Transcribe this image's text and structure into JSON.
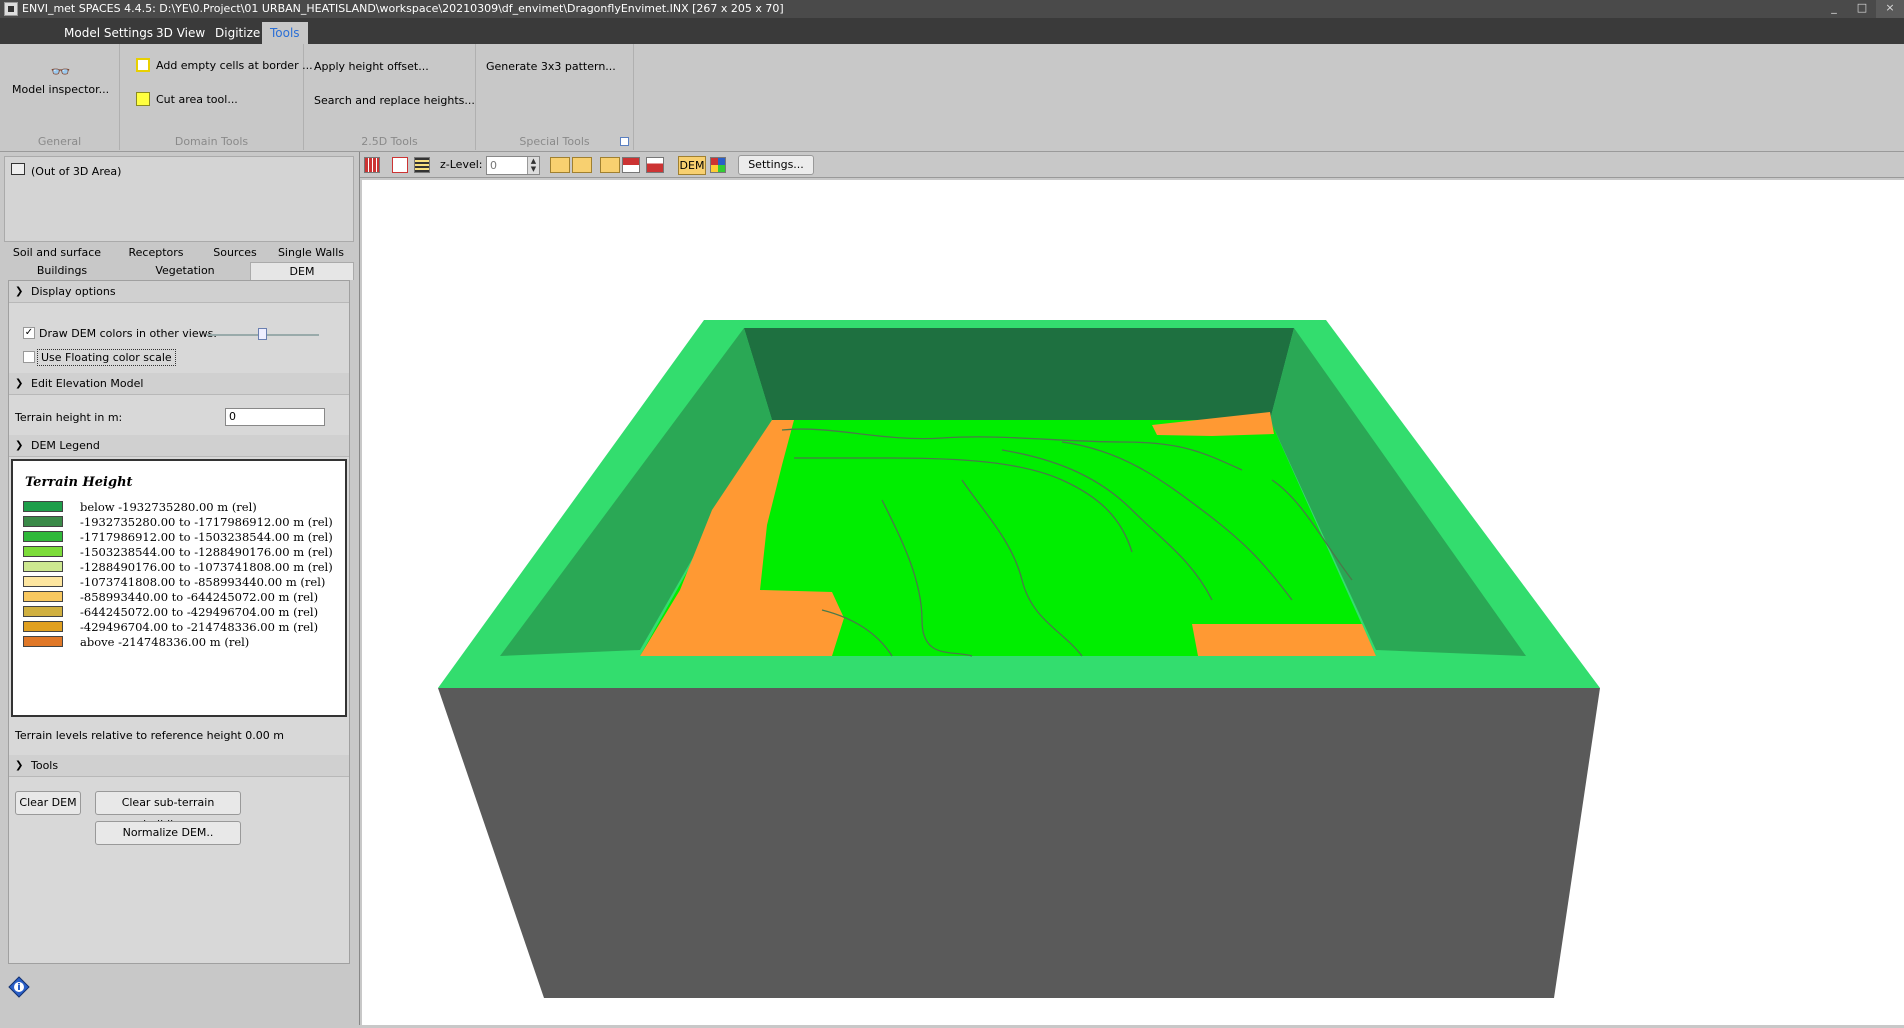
{
  "window": {
    "title": "ENVI_met SPACES 4.4.5:  D:\\YE\\0.Project\\01 URBAN_HEATISLAND\\workspace\\20210309\\df_envimet\\DragonflyEnvimet.INX [267 x 205 x 70]",
    "controls": [
      "_",
      "□",
      "×"
    ]
  },
  "menu": {
    "tabs": [
      "Model Settings",
      "3D View",
      "Digitize",
      "Tools"
    ],
    "active": "Tools"
  },
  "ribbon": {
    "groups": {
      "general": {
        "label": "General",
        "model_inspector": "Model inspector..."
      },
      "domain": {
        "label": "Domain Tools",
        "add_empty_cells": "Add empty cells at border ...",
        "cut_area": "Cut area tool..."
      },
      "two_half_d": {
        "label": "2.5D Tools",
        "apply_height": "Apply height offset...",
        "search_replace": "Search and replace heights..."
      },
      "special": {
        "label": "Special Tools",
        "generate_pattern": "Generate 3x3 pattern..."
      }
    }
  },
  "left_panel": {
    "area_label": "(Out of 3D Area)",
    "tabs_row1": [
      "Soil and surface",
      "Receptors",
      "Sources",
      "Single Walls"
    ],
    "tabs_row2": [
      "Buildings",
      "Vegetation",
      "DEM"
    ],
    "active_tab": "DEM",
    "display_options": {
      "title": "Display options",
      "draw_dem_colors": "Draw DEM colors in other views.",
      "draw_dem_checked": true,
      "floating_scale": "Use Floating color scale",
      "floating_checked": false,
      "slider_level": 0.5
    },
    "edit_elevation": {
      "title": "Edit Elevation Model",
      "terrain_label": "Terrain height in m:",
      "terrain_value": "0"
    },
    "legend": {
      "title": "DEM Legend",
      "heading": "Terrain Height",
      "entries": [
        {
          "color": "#1e9e4a",
          "label": "below -1932735280.00 m (rel)"
        },
        {
          "color": "#3a8a48",
          "label": "-1932735280.00 to -1717986912.00 m (rel)"
        },
        {
          "color": "#2fb83a",
          "label": "-1717986912.00 to -1503238544.00 m (rel)"
        },
        {
          "color": "#7cdc3a",
          "label": "-1503238544.00 to -1288490176.00 m (rel)"
        },
        {
          "color": "#cde890",
          "label": "-1288490176.00 to -1073741808.00 m (rel)"
        },
        {
          "color": "#fde6a0",
          "label": "-1073741808.00 to -858993440.00 m (rel)"
        },
        {
          "color": "#f8c860",
          "label": "-858993440.00 to -644245072.00 m (rel)"
        },
        {
          "color": "#d0b040",
          "label": "-644245072.00 to -429496704.00 m (rel)"
        },
        {
          "color": "#e0a020",
          "label": "-429496704.00 to -214748336.00 m (rel)"
        },
        {
          "color": "#e07828",
          "label": "above -214748336.00 m (rel)"
        }
      ],
      "footer": "Terrain levels relative to reference height 0.00 m"
    },
    "tools": {
      "title": "Tools",
      "clear_dem": "Clear DEM",
      "clear_sub": "Clear sub-terrain buildings",
      "normalize": "Normalize DEM.."
    }
  },
  "view_toolbar": {
    "z_label": "z-Level:",
    "z_value": "0",
    "dem_label": "DEM",
    "settings_label": "Settings..."
  },
  "view3d": {
    "colors": {
      "frame_top": "#33dd6e",
      "inner_wall_back": "#1e7040",
      "inner_wall_side": "#2aa855",
      "outer_wall": "#5a5a5a",
      "terrain_green": "#00ee00",
      "terrain_orange": "#ff9933",
      "contour": "#4a7a4a"
    }
  }
}
